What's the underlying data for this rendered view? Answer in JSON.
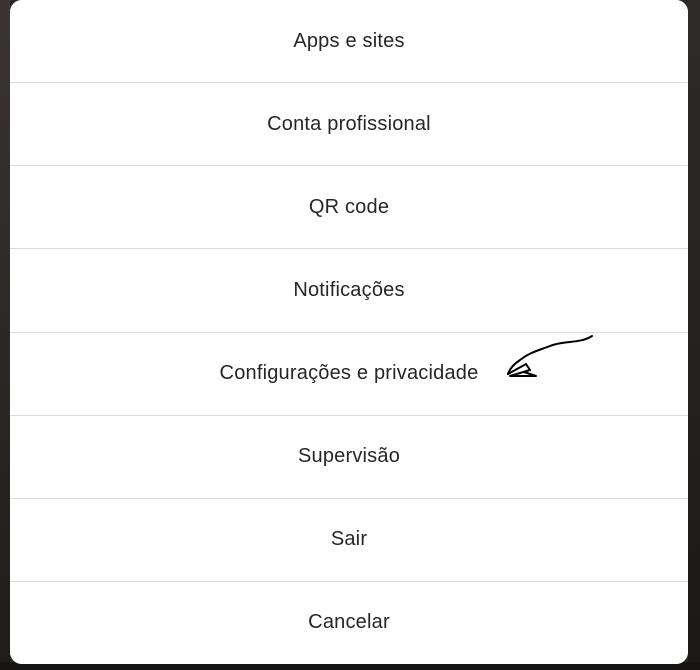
{
  "menu": {
    "items": [
      {
        "label": "Apps e sites"
      },
      {
        "label": "Conta profissional"
      },
      {
        "label": "QR code"
      },
      {
        "label": "Notificações"
      },
      {
        "label": "Configurações e privacidade"
      },
      {
        "label": "Supervisão"
      },
      {
        "label": "Sair"
      },
      {
        "label": "Cancelar"
      }
    ]
  },
  "annotation": {
    "icon": "hand-drawn-arrow-icon",
    "color": "#000000"
  }
}
